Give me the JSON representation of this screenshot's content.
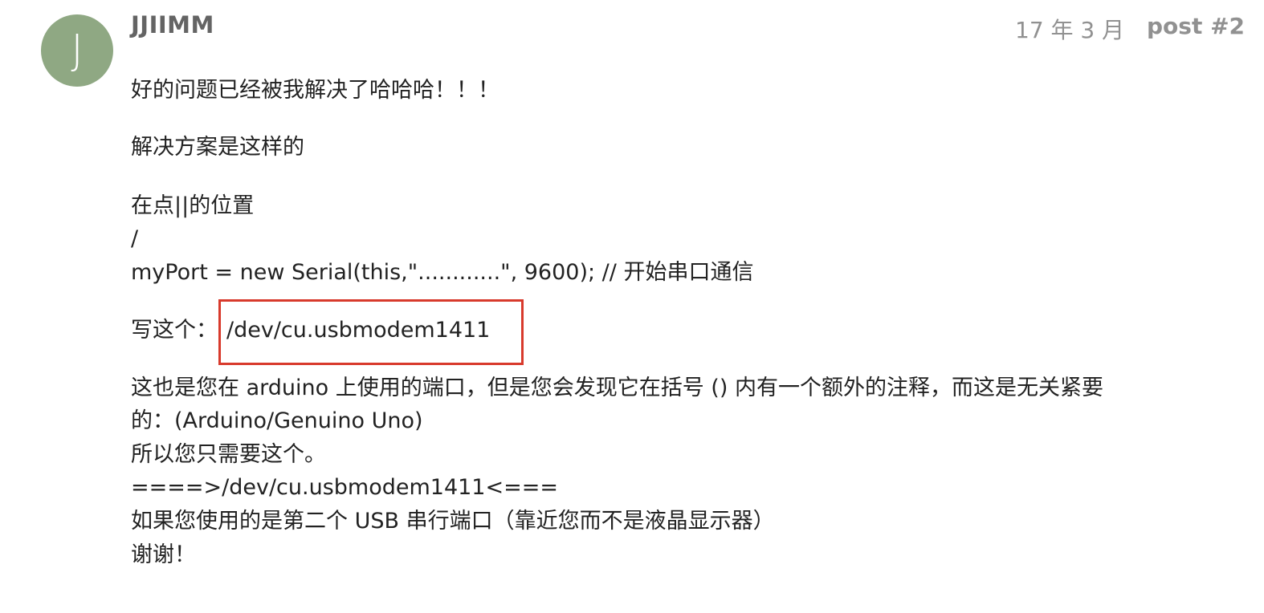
{
  "post": {
    "avatar_letter": "J",
    "username": "JJIIMM",
    "date": "17 年 3 月",
    "post_number": "post #2"
  },
  "content": {
    "line1": "好的问题已经被我解决了哈哈哈！！！",
    "line2": "解决方案是这样的",
    "line3": "在点||的位置",
    "line4": "/",
    "line5": "myPort = new Serial(this,\"............\", 9600); // 开始串口通信",
    "write_label": "写这个：",
    "highlight": "/dev/cu.usbmodem1411",
    "para_line1": "这也是您在 arduino 上使用的端口，但是您会发现它在括号 () 内有一个额外的注释，而这是无关紧要",
    "para_line2": "的：(Arduino/Genuino Uno)",
    "para_line3": "所以您只需要这个。",
    "para_line4": "====>/dev/cu.usbmodem1411<===",
    "para_line5": "如果您使用的是第二个 USB 串行端口（靠近您而不是液晶显示器）",
    "para_line6": "谢谢！"
  },
  "colors": {
    "avatar_bg": "#8fa883",
    "highlight_border": "#d83a2c",
    "meta_text": "#919191"
  }
}
